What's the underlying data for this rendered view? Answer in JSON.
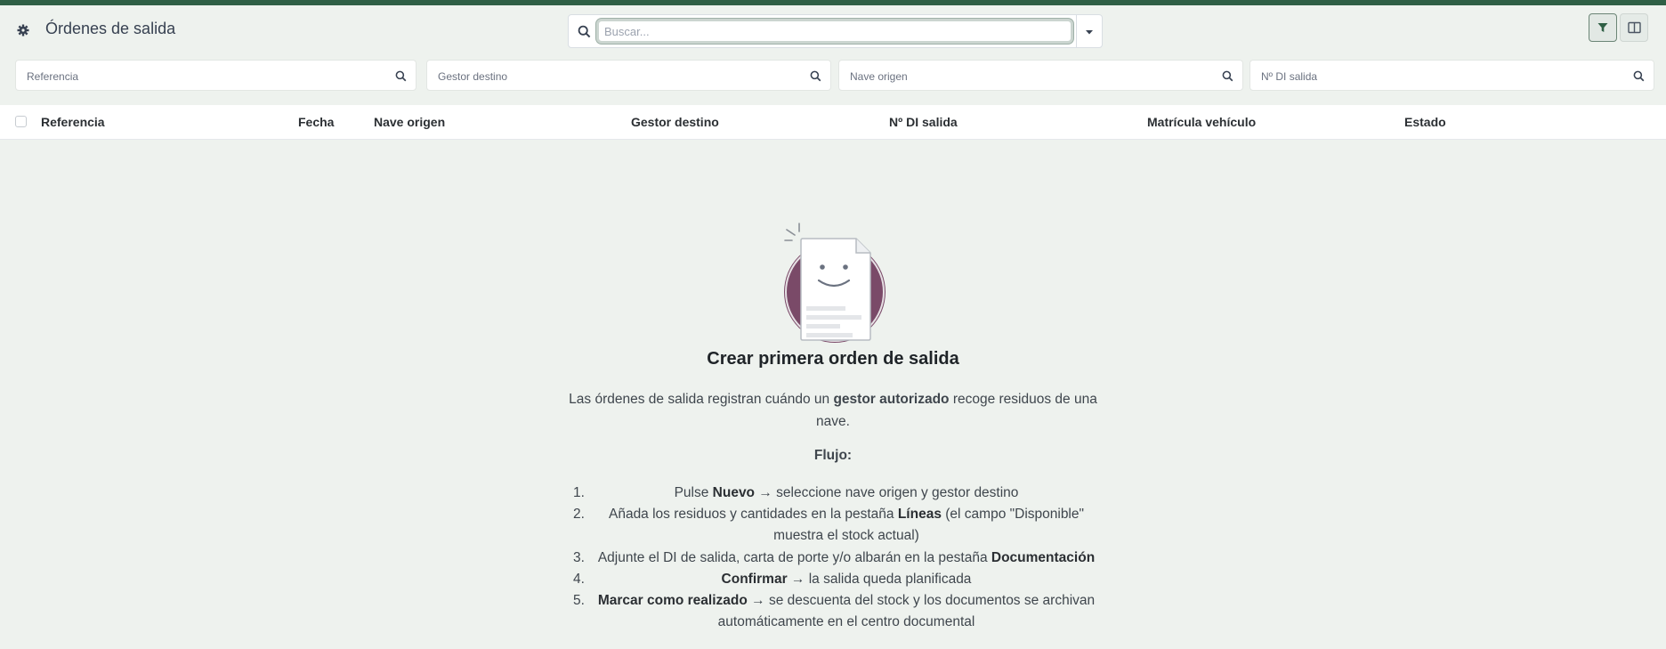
{
  "app": {
    "title": "Órdenes de salida"
  },
  "search": {
    "placeholder": "Buscar..."
  },
  "filters": [
    {
      "placeholder": "Referencia"
    },
    {
      "placeholder": "Gestor destino"
    },
    {
      "placeholder": "Nave origen"
    },
    {
      "placeholder": "Nº DI salida"
    }
  ],
  "table": {
    "columns": [
      "Referencia",
      "Fecha",
      "Nave origen",
      "Gestor destino",
      "Nº DI salida",
      "Matrícula vehículo",
      "Estado"
    ]
  },
  "empty": {
    "title": "Crear primera orden de salida",
    "desc_pre": "Las órdenes de salida registran cuándo un ",
    "desc_bold": "gestor autorizado",
    "desc_post": " recoge residuos de una nave.",
    "flow_label": "Flujo:",
    "steps": [
      {
        "num": "1.",
        "pre": "Pulse ",
        "bold": "Nuevo",
        "post": " → seleccione nave origen y gestor destino"
      },
      {
        "num": "2.",
        "pre": "Añada los residuos y cantidades en la pestaña ",
        "bold": "Líneas",
        "post": " (el campo \"Disponible\" muestra el stock actual)"
      },
      {
        "num": "3.",
        "pre": "Adjunte el DI de salida, carta de porte y/o albarán en la pestaña ",
        "bold": "Documentación",
        "post": ""
      },
      {
        "num": "4.",
        "pre": "",
        "bold": "Confirmar",
        "post": " → la salida queda planificada"
      },
      {
        "num": "5.",
        "pre": "",
        "bold": "Marcar como realizado",
        "post": " → se descuenta del stock y los documentos se archivan automáticamente en el centro documental"
      }
    ]
  },
  "colors": {
    "brand": "#2f5f45",
    "background": "#eef2ee",
    "illustration_circle": "#7a4a68"
  },
  "icons": [
    "gear-icon",
    "search-icon",
    "caret-down-icon",
    "filter-icon",
    "layout-icon"
  ]
}
